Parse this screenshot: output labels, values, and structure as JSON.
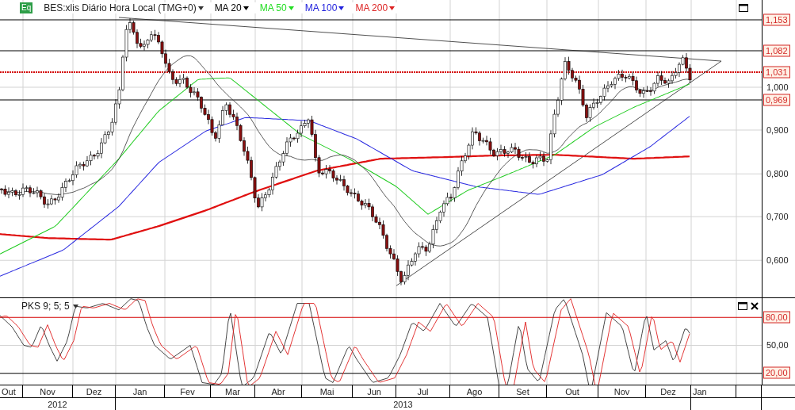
{
  "legend": {
    "badge": "Eq",
    "symbol": "BES:xlis Diário Hora Local (TMG+0)",
    "indicators": [
      {
        "label": "MA 20",
        "color": "#000000"
      },
      {
        "label": "MA 50",
        "color": "#22dd22"
      },
      {
        "label": "MA 100",
        "color": "#2222dd"
      },
      {
        "label": "MA 200",
        "color": "#dd2222"
      }
    ]
  },
  "price_axis": {
    "ticks": [
      "1,000",
      "0,900",
      "0,800",
      "0,700",
      "0,600"
    ],
    "markers": [
      {
        "label": "1,153",
        "kind": "solid"
      },
      {
        "label": "1,082",
        "kind": "solid"
      },
      {
        "label": "1,031",
        "kind": "dotted"
      },
      {
        "label": "0,969",
        "kind": "solid"
      }
    ]
  },
  "oscillator": {
    "label": "PKS 9; 5; 5",
    "ticks": [
      {
        "label": "80,00",
        "kind": "marker"
      },
      {
        "label": "50,00",
        "kind": "plain"
      },
      {
        "label": "20,00",
        "kind": "marker"
      }
    ]
  },
  "months": [
    "Out",
    "Nov",
    "Dez",
    "Jan",
    "Fev",
    "Mar",
    "Abr",
    "Mai",
    "Jun",
    "Jul",
    "Ago",
    "Set",
    "Out",
    "Nov",
    "Dez",
    "Jan"
  ],
  "years": [
    "2012",
    "2013"
  ]
}
